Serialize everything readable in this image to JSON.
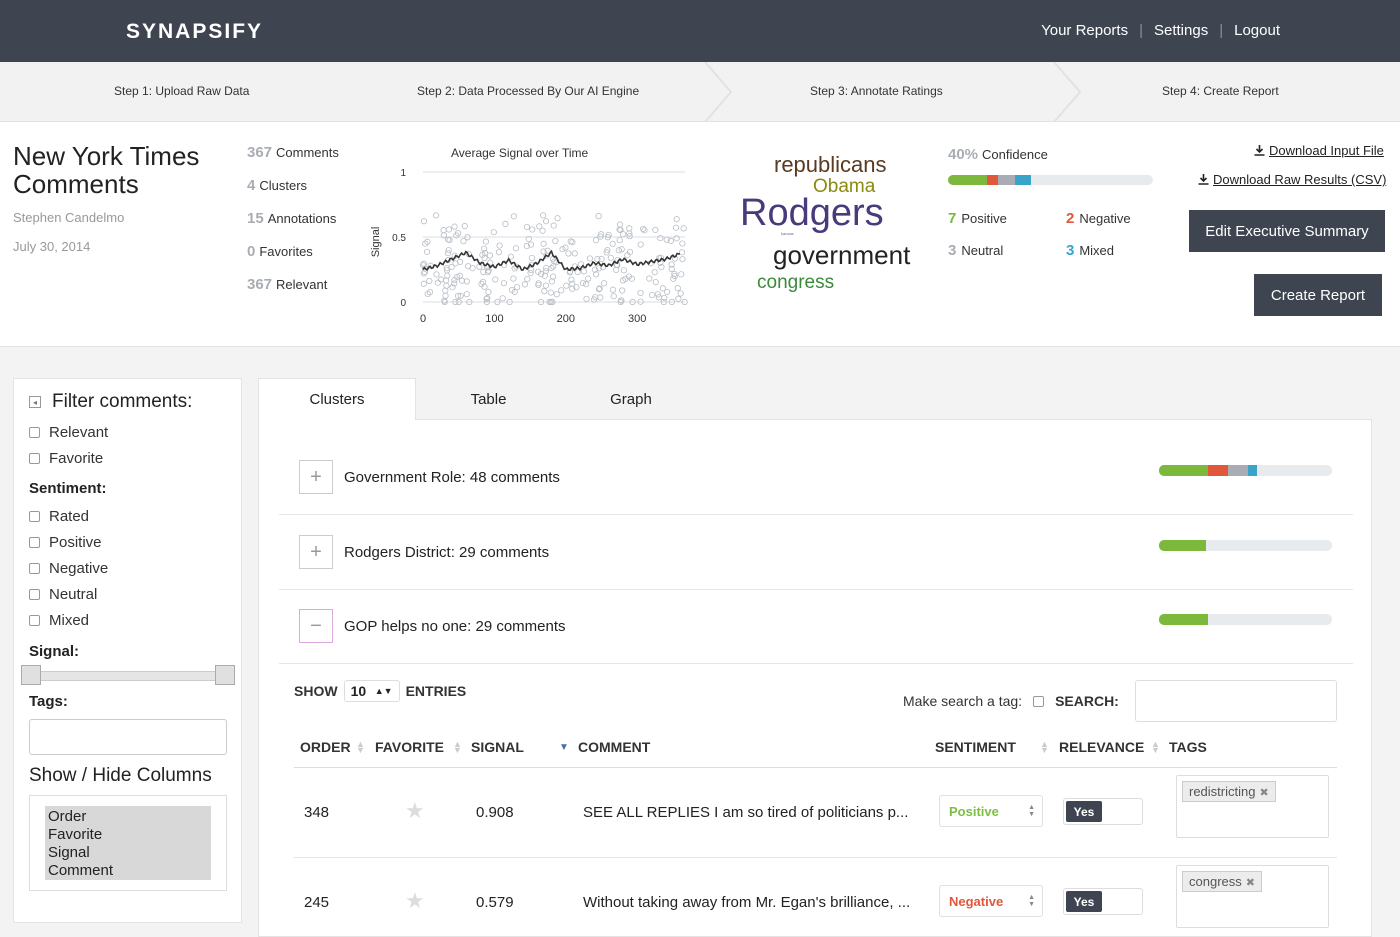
{
  "header": {
    "logo": "SYNAPSIFY",
    "nav": [
      "Your Reports",
      "Settings",
      "Logout"
    ],
    "separator": "|"
  },
  "steps": [
    "Step 1: Upload Raw Data",
    "Step 2: Data Processed By Our AI Engine",
    "Step 3: Annotate Ratings",
    "Step 4: Create Report"
  ],
  "document": {
    "title_line1": "New York Times",
    "title_line2": "Comments",
    "author": "Stephen Candelmo",
    "date": "July 30, 2014"
  },
  "stats": [
    {
      "num": "367",
      "label": "Comments"
    },
    {
      "num": "4",
      "label": "Clusters"
    },
    {
      "num": "15",
      "label": "Annotations"
    },
    {
      "num": "0",
      "label": "Favorites"
    },
    {
      "num": "367",
      "label": "Relevant"
    }
  ],
  "chart_data": {
    "type": "scatter",
    "title": "Average Signal over Time",
    "xlabel": "",
    "ylabel": "Signal",
    "xlim": [
      0,
      367
    ],
    "ylim": [
      0,
      1
    ],
    "x_ticks": [
      "0",
      "100",
      "200",
      "300"
    ],
    "y_ticks": [
      "0",
      "0.5",
      "1"
    ],
    "grid": "horizontal",
    "series": [
      {
        "kind": "points",
        "note": "individual comment signals scattered between 0.0 and 0.85"
      },
      {
        "kind": "moving_average",
        "x": [
          0,
          20,
          40,
          60,
          80,
          100,
          120,
          140,
          160,
          180,
          200,
          220,
          240,
          260,
          280,
          300,
          320,
          340,
          360
        ],
        "y": [
          0.25,
          0.28,
          0.33,
          0.38,
          0.3,
          0.27,
          0.32,
          0.25,
          0.3,
          0.38,
          0.25,
          0.26,
          0.3,
          0.28,
          0.33,
          0.29,
          0.31,
          0.33,
          0.37
        ]
      }
    ]
  },
  "word_cloud": [
    {
      "text": "republicans",
      "color": "#5a3a20"
    },
    {
      "text": "Obama",
      "color": "#8a8a10"
    },
    {
      "text": "Rodgers",
      "color": "#4a3a7a"
    },
    {
      "text": "kansas",
      "color": "#6a6aa0"
    },
    {
      "text": "government",
      "color": "#222222"
    },
    {
      "text": "congress",
      "color": "#3a8a3a"
    }
  ],
  "confidence": {
    "num": "40%",
    "label": "Confidence",
    "value": 0.4
  },
  "sentiment_summary": {
    "positive": {
      "num": "7",
      "label": "Positive",
      "color": "#7bb83c"
    },
    "negative": {
      "num": "2",
      "label": "Negative",
      "color": "#e0573a"
    },
    "neutral": {
      "num": "3",
      "label": "Neutral",
      "color": "#a9adb3"
    },
    "mixed": {
      "num": "3",
      "label": "Mixed",
      "color": "#3aa3c9"
    }
  },
  "actions": {
    "download_input": "Download Input File",
    "download_raw": "Download Raw Results (CSV)",
    "edit_summary": "Edit Executive Summary",
    "create_report": "Create Report"
  },
  "filter": {
    "title": "Filter comments:",
    "relevant": "Relevant",
    "favorite": "Favorite",
    "sentiment_label": "Sentiment:",
    "sentiments": [
      "Rated",
      "Positive",
      "Negative",
      "Neutral",
      "Mixed"
    ],
    "signal_label": "Signal:",
    "tags_label": "Tags:",
    "showhide_label": "Show / Hide Columns",
    "columns": [
      "Order",
      "Favorite",
      "Signal",
      "Comment"
    ]
  },
  "tabs": [
    "Clusters",
    "Table",
    "Graph"
  ],
  "clusters": [
    {
      "label": "Government Role: 48 comments",
      "toggle": "+",
      "bar": {
        "positive": 0.28,
        "negative": 0.12,
        "neutral": 0.12,
        "mixed": 0.05
      }
    },
    {
      "label": "Rodgers District: 29 comments",
      "toggle": "+",
      "bar": {
        "positive": 0.27
      }
    },
    {
      "label": "GOP helps no one: 29 comments",
      "toggle": "−",
      "bar": {
        "positive": 0.28
      }
    }
  ],
  "table": {
    "show_label": "SHOW",
    "entries_value": "10",
    "entries_label": "ENTRIES",
    "search_tag_label": "Make search a tag:",
    "search_label": "SEARCH:",
    "columns": [
      "ORDER",
      "FAVORITE",
      "SIGNAL",
      "COMMENT",
      "SENTIMENT",
      "RELEVANCE",
      "TAGS"
    ],
    "rows": [
      {
        "order": "348",
        "signal": "0.908",
        "comment": "SEE ALL REPLIES I am so tired of politicians p...",
        "sentiment": "Positive",
        "sentiment_color": "#7bc043",
        "relevance": "Yes",
        "tag": "redistricting"
      },
      {
        "order": "245",
        "signal": "0.579",
        "comment": "Without taking away from Mr. Egan's brilliance, ...",
        "sentiment": "Negative",
        "sentiment_color": "#e0573a",
        "relevance": "Yes",
        "tag": "congress"
      }
    ]
  }
}
